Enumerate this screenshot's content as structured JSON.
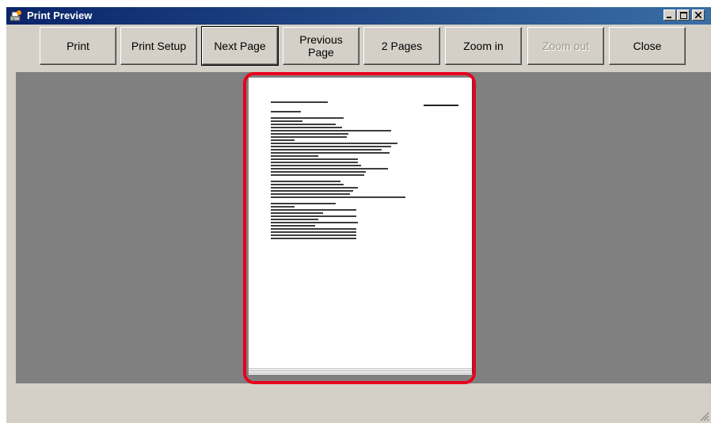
{
  "window": {
    "title": "Print Preview",
    "icon": "print-preview-app-icon"
  },
  "caption_buttons": {
    "minimize": "minimize-icon",
    "maximize": "maximize-icon",
    "close": "close-icon"
  },
  "toolbar": {
    "print": "Print",
    "print_setup": "Print Setup",
    "next_page": "Next Page",
    "previous_page_line1": "Previous",
    "previous_page_line2": "Page",
    "two_pages": "2 Pages",
    "zoom_in": "Zoom in",
    "zoom_out": "Zoom out",
    "close": "Close"
  },
  "colors": {
    "titlebar": "#0a246a",
    "preview_background": "#808080",
    "highlight": "#e8001c"
  }
}
